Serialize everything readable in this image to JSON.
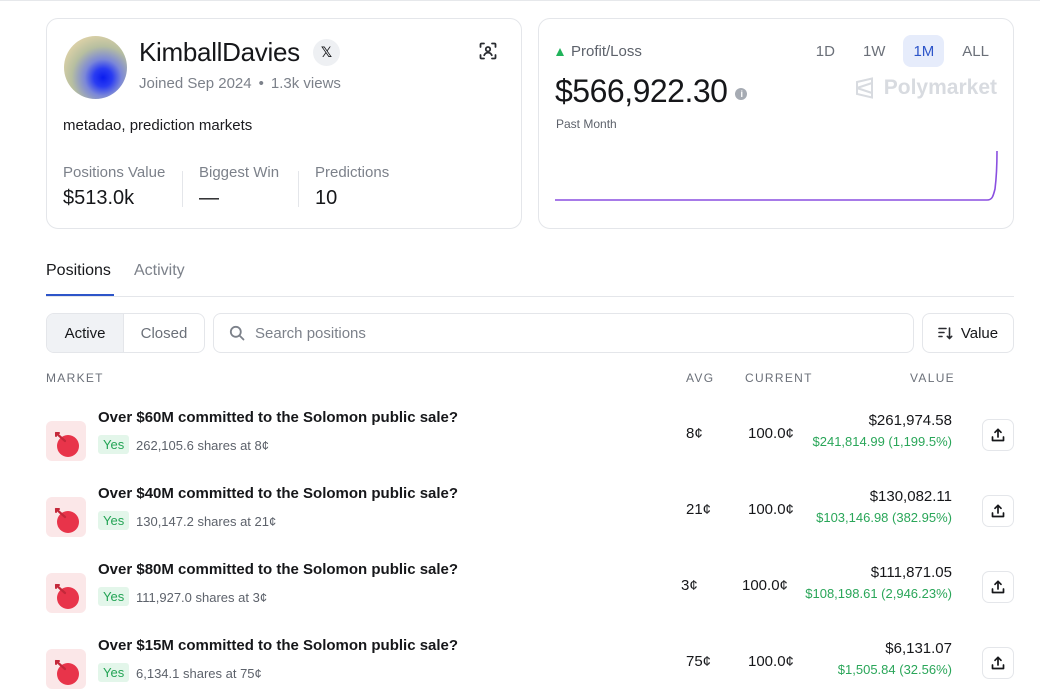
{
  "profile": {
    "username": "KimballDavies",
    "x_icon": "x-logo-icon",
    "joined": "Joined Sep 2024",
    "views": "1.3k views",
    "bio": "metadao, prediction markets",
    "stats": [
      {
        "label": "Positions Value",
        "value": "$513.0k"
      },
      {
        "label": "Biggest Win",
        "value": "—"
      },
      {
        "label": "Predictions",
        "value": "10"
      }
    ]
  },
  "pnl": {
    "label": "Profit/Loss",
    "value": "$566,922.30",
    "period": "Past Month",
    "ranges": [
      "1D",
      "1W",
      "1M",
      "ALL"
    ],
    "active_range": "1M",
    "watermark": "Polymarket",
    "line_color": "#8a4fe0",
    "trend_color": "#21b35b"
  },
  "tabs": {
    "positions": "Positions",
    "activity": "Activity",
    "active": "Positions"
  },
  "filters": {
    "active": "Active",
    "closed": "Closed",
    "search_placeholder": "Search positions",
    "sort_label": "Value"
  },
  "columns": {
    "market": "MARKET",
    "avg": "AVG",
    "current": "CURRENT",
    "value": "VALUE"
  },
  "positions": [
    {
      "title": "Over $60M committed to the Solomon public sale?",
      "outcome": "Yes",
      "shares": "262,105.6 shares at 8¢",
      "avg": "8¢",
      "current": "100.0¢",
      "value": "$261,974.58",
      "gain": "$241,814.99 (1,199.5%)"
    },
    {
      "title": "Over $40M committed to the Solomon public sale?",
      "outcome": "Yes",
      "shares": "130,147.2 shares at 21¢",
      "avg": "21¢",
      "current": "100.0¢",
      "value": "$130,082.11",
      "gain": "$103,146.98 (382.95%)"
    },
    {
      "title": "Over $80M committed to the Solomon public sale?",
      "outcome": "Yes",
      "shares": "111,927.0 shares at 3¢",
      "avg": "3¢",
      "current": "100.0¢",
      "value": "$111,871.05",
      "gain": "$108,198.61 (2,946.23%)"
    },
    {
      "title": "Over $15M committed to the Solomon public sale?",
      "outcome": "Yes",
      "shares": "6,134.1 shares at 75¢",
      "avg": "75¢",
      "current": "100.0¢",
      "value": "$6,131.07",
      "gain": "$1,505.84 (32.56%)"
    }
  ],
  "colors": {
    "accent": "#2d55c9",
    "gain": "#2aa659",
    "yes_bg": "#e3f6ea"
  }
}
